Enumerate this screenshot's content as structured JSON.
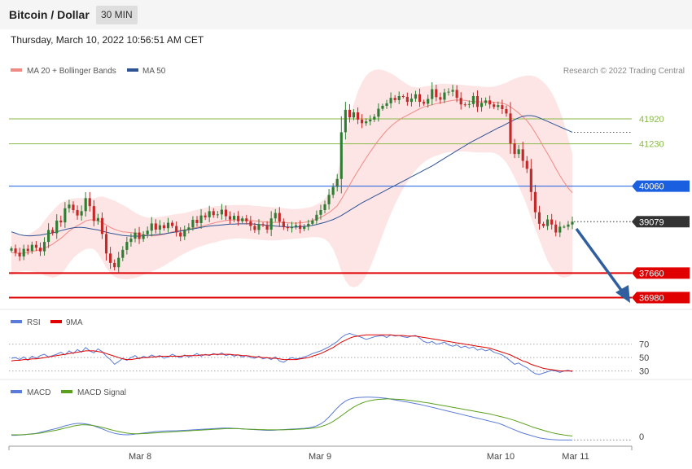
{
  "header": {
    "title": "Bitcoin / Dollar",
    "timeframe": "30 MIN",
    "timestamp": "Thursday, March 10, 2022 10:56:51 AM CET"
  },
  "colors": {
    "ma20": "#f08a84",
    "bb_fill": "#fde0e0",
    "ma50": "#2e5395",
    "up": "#2e7d32",
    "down": "#c62828",
    "support": "#e00000",
    "blue_level": "#1a5fe0",
    "green_level": "#8ab84a",
    "rsi": "#5a7bd8",
    "rsi_ma": "#e00000",
    "macd": "#5a7bd8",
    "macd_signal": "#5aa01e",
    "arrow": "#2f5f9e"
  },
  "chart_data": [
    {
      "type": "candlestick",
      "title": "",
      "legend": [
        {
          "name": "MA 20 + Bollinger Bands",
          "color": "#f08a84"
        },
        {
          "name": "MA 50",
          "color": "#2e5395"
        }
      ],
      "credit": "Research © 2022 Trading Central",
      "x_ticks": [
        "Mar 8",
        "Mar 9",
        "Mar 10",
        "Mar 11"
      ],
      "ylim": [
        36700,
        43000
      ],
      "levels": [
        {
          "value": 41920,
          "label": "41920",
          "style": "resistance"
        },
        {
          "value": 41230,
          "label": "41230",
          "style": "resistance"
        },
        {
          "value": 40060,
          "label": "40060",
          "style": "pivot"
        },
        {
          "value": 39079,
          "label": "39079",
          "style": "current"
        },
        {
          "value": 37660,
          "label": "37660",
          "style": "support"
        },
        {
          "value": 36980,
          "label": "36980",
          "style": "support"
        }
      ],
      "close": [
        38340,
        38220,
        38120,
        38330,
        38270,
        38440,
        38360,
        38260,
        38520,
        38850,
        38760,
        39110,
        39060,
        39450,
        39550,
        39400,
        39250,
        39370,
        39730,
        39510,
        39100,
        39180,
        38740,
        38200,
        37940,
        37820,
        38080,
        38300,
        38520,
        38610,
        38780,
        38600,
        38730,
        38830,
        39030,
        38860,
        38980,
        38900,
        39050,
        38960,
        38780,
        38670,
        38860,
        38920,
        39130,
        39040,
        39250,
        39200,
        39370,
        39260,
        39280,
        39410,
        39230,
        39140,
        39240,
        39090,
        39170,
        39090,
        38960,
        38850,
        39010,
        38980,
        38860,
        39170,
        39320,
        39080,
        38930,
        38900,
        38940,
        38980,
        38880,
        38940,
        39020,
        39110,
        39270,
        39400,
        39560,
        39820,
        40040,
        40260,
        41550,
        42170,
        41960,
        42100,
        41900,
        41800,
        41850,
        41900,
        41980,
        42200,
        42280,
        42350,
        42500,
        42440,
        42550,
        42530,
        42390,
        42480,
        42600,
        42390,
        42340,
        42470,
        42740,
        42520,
        42450,
        42650,
        42670,
        42720,
        42500,
        42320,
        42310,
        42330,
        42550,
        42250,
        42360,
        42430,
        42320,
        42250,
        42300,
        42190,
        42070,
        41240,
        40950,
        41080,
        40760,
        40540,
        39900,
        39340,
        39020,
        38960,
        39140,
        39000,
        38780,
        38940,
        38940,
        39000,
        39079
      ],
      "ma20": [
        38230,
        38210,
        38200,
        38210,
        38230,
        38260,
        38280,
        38300,
        38340,
        38400,
        38460,
        38540,
        38620,
        38720,
        38820,
        38900,
        38970,
        39030,
        39100,
        39130,
        39130,
        39100,
        39050,
        38990,
        38920,
        38870,
        38830,
        38800,
        38790,
        38780,
        38760,
        38740,
        38720,
        38700,
        38690,
        38690,
        38710,
        38730,
        38760,
        38800,
        38820,
        38830,
        38850,
        38870,
        38900,
        38920,
        38950,
        38980,
        39010,
        39040,
        39070,
        39090,
        39110,
        39120,
        39130,
        39130,
        39130,
        39120,
        39110,
        39100,
        39090,
        39080,
        39070,
        39060,
        39060,
        39060,
        39060,
        39050,
        39040,
        39040,
        39050,
        39060,
        39080,
        39110,
        39150,
        39200,
        39260,
        39330,
        39420,
        39520,
        39700,
        39900,
        40090,
        40290,
        40480,
        40660,
        40840,
        41010,
        41170,
        41330,
        41470,
        41600,
        41710,
        41810,
        41890,
        41960,
        42020,
        42080,
        42140,
        42200,
        42250,
        42280,
        42310,
        42340,
        42360,
        42390,
        42410,
        42430,
        42440,
        42440,
        42430,
        42410,
        42400,
        42390,
        42390,
        42390,
        42390,
        42380,
        42370,
        42350,
        42320,
        42250,
        42170,
        42080,
        41980,
        41870,
        41720,
        41540,
        41350,
        41150,
        40960,
        40760,
        40550,
        40350,
        40170,
        40010,
        39880
      ],
      "bb_upper": [
        38800,
        38740,
        38700,
        38700,
        38720,
        38780,
        38850,
        38950,
        39100,
        39250,
        39380,
        39500,
        39600,
        39660,
        39700,
        39720,
        39730,
        39730,
        39730,
        39720,
        39720,
        39760,
        39780,
        39740,
        39700,
        39660,
        39600,
        39540,
        39480,
        39400,
        39330,
        39270,
        39220,
        39190,
        39190,
        39200,
        39210,
        39230,
        39250,
        39270,
        39290,
        39300,
        39320,
        39350,
        39380,
        39410,
        39440,
        39460,
        39480,
        39500,
        39510,
        39520,
        39530,
        39530,
        39540,
        39540,
        39540,
        39540,
        39530,
        39520,
        39510,
        39500,
        39490,
        39480,
        39470,
        39460,
        39450,
        39440,
        39430,
        39430,
        39440,
        39450,
        39470,
        39500,
        39550,
        39620,
        39720,
        39860,
        40080,
        40370,
        40870,
        41420,
        41910,
        42330,
        42680,
        42930,
        43110,
        43220,
        43270,
        43290,
        43270,
        43230,
        43180,
        43110,
        43030,
        42950,
        42870,
        42810,
        42790,
        42790,
        42810,
        42830,
        42850,
        42870,
        42890,
        42890,
        42880,
        42880,
        42870,
        42860,
        42850,
        42840,
        42830,
        42820,
        42810,
        42800,
        42800,
        42810,
        42840,
        42880,
        42920,
        42980,
        43030,
        43070,
        43100,
        43120,
        43120,
        43090,
        43030,
        42940,
        42810,
        42640,
        42420,
        42140,
        41800,
        41400,
        40960
      ],
      "bb_lower": [
        37600,
        37650,
        37700,
        37720,
        37720,
        37700,
        37680,
        37650,
        37600,
        37560,
        37530,
        37560,
        37620,
        37760,
        37930,
        38070,
        38180,
        38260,
        38320,
        38340,
        38320,
        38200,
        38010,
        37800,
        37650,
        37560,
        37510,
        37490,
        37480,
        37500,
        37520,
        37560,
        37610,
        37650,
        37700,
        37750,
        37800,
        37860,
        37930,
        38000,
        38070,
        38140,
        38200,
        38260,
        38310,
        38360,
        38400,
        38440,
        38470,
        38500,
        38530,
        38560,
        38580,
        38600,
        38610,
        38620,
        38620,
        38610,
        38600,
        38590,
        38580,
        38570,
        38560,
        38560,
        38560,
        38570,
        38580,
        38590,
        38600,
        38610,
        38620,
        38630,
        38640,
        38650,
        38650,
        38640,
        38600,
        38500,
        38320,
        38050,
        37700,
        37450,
        37300,
        37270,
        37300,
        37410,
        37590,
        37820,
        38100,
        38410,
        38720,
        39020,
        39300,
        39560,
        39790,
        40000,
        40180,
        40350,
        40500,
        40620,
        40720,
        40800,
        40860,
        40900,
        40940,
        40980,
        41000,
        41010,
        41020,
        41020,
        41020,
        41010,
        41000,
        40990,
        40990,
        40990,
        40990,
        40980,
        40930,
        40840,
        40710,
        40520,
        40300,
        40060,
        39800,
        39520,
        39200,
        38880,
        38580,
        38280,
        38000,
        37800,
        37650,
        37560,
        37530,
        37560,
        37620
      ],
      "ma50": [
        38800,
        38760,
        38720,
        38700,
        38690,
        38690,
        38700,
        38710,
        38730,
        38750,
        38770,
        38800,
        38830,
        38860,
        38890,
        38910,
        38920,
        38920,
        38910,
        38890,
        38870,
        38850,
        38820,
        38790,
        38760,
        38740,
        38720,
        38700,
        38690,
        38680,
        38680,
        38680,
        38690,
        38700,
        38710,
        38720,
        38730,
        38740,
        38760,
        38780,
        38800,
        38820,
        38840,
        38860,
        38880,
        38900,
        38920,
        38940,
        38960,
        38970,
        38980,
        38990,
        39000,
        39010,
        39010,
        39020,
        39020,
        39020,
        39020,
        39010,
        39000,
        38990,
        38980,
        38970,
        38960,
        38950,
        38940,
        38930,
        38930,
        38930,
        38940,
        38950,
        38960,
        38980,
        39000,
        39030,
        39060,
        39100,
        39140,
        39190,
        39250,
        39320,
        39390,
        39460,
        39530,
        39600,
        39660,
        39720,
        39780,
        39840,
        39900,
        39960,
        40020,
        40080,
        40140,
        40200,
        40260,
        40320,
        40380,
        40440,
        40500,
        40560,
        40620,
        40690,
        40760,
        40830,
        40900,
        40970,
        41040,
        41110,
        41180,
        41250,
        41310,
        41370,
        41430,
        41490,
        41550,
        41610,
        41670,
        41720,
        41780,
        41840,
        41900,
        41950,
        41990,
        42010,
        42010,
        41990,
        41950,
        41900,
        41850,
        41800,
        41750,
        41700,
        41650,
        41600,
        41550
      ]
    },
    {
      "type": "line",
      "title": "",
      "legend": [
        {
          "name": "RSI",
          "color": "#5a7bd8"
        },
        {
          "name": "9MA",
          "color": "#e00000"
        }
      ],
      "ylim": [
        15,
        100
      ],
      "y_ticks": [
        "70",
        "50",
        "30"
      ],
      "levels": [
        70,
        50,
        30
      ],
      "rsi": [
        49,
        50,
        47,
        51,
        46,
        52,
        49,
        53,
        55,
        51,
        53,
        55,
        58,
        54,
        60,
        56,
        62,
        58,
        65,
        60,
        57,
        63,
        59,
        52,
        47,
        40,
        44,
        49,
        46,
        50,
        53,
        48,
        52,
        50,
        54,
        51,
        53,
        49,
        51,
        55,
        52,
        50,
        54,
        51,
        53,
        56,
        52,
        55,
        53,
        56,
        54,
        57,
        53,
        55,
        52,
        54,
        51,
        53,
        50,
        49,
        52,
        48,
        50,
        47,
        51,
        45,
        43,
        47,
        50,
        48,
        49,
        51,
        53,
        56,
        58,
        60,
        63,
        66,
        70,
        74,
        80,
        84,
        86,
        84,
        82,
        80,
        77,
        79,
        81,
        82,
        83,
        80,
        84,
        82,
        83,
        81,
        80,
        82,
        83,
        79,
        74,
        72,
        74,
        70,
        71,
        73,
        69,
        67,
        69,
        65,
        67,
        64,
        66,
        61,
        63,
        60,
        62,
        58,
        56,
        54,
        50,
        45,
        40,
        42,
        38,
        35,
        30,
        26,
        25,
        27,
        29,
        31,
        30,
        28,
        30,
        31,
        29
      ],
      "rsi_ma": [
        45,
        46,
        46,
        47,
        47,
        48,
        48,
        49,
        50,
        51,
        52,
        53,
        54,
        55,
        56,
        57,
        58,
        59,
        60,
        60,
        60,
        59,
        58,
        56,
        54,
        52,
        50,
        48,
        47,
        47,
        48,
        49,
        50,
        50,
        51,
        51,
        52,
        52,
        52,
        52,
        52,
        52,
        53,
        53,
        53,
        53,
        54,
        54,
        54,
        55,
        55,
        55,
        55,
        55,
        54,
        54,
        53,
        53,
        52,
        51,
        51,
        50,
        50,
        49,
        49,
        48,
        47,
        47,
        47,
        47,
        48,
        49,
        50,
        52,
        54,
        56,
        59,
        62,
        65,
        69,
        73,
        76,
        79,
        81,
        82,
        83,
        84,
        84,
        84,
        84,
        84,
        84,
        84,
        83,
        83,
        83,
        82,
        82,
        82,
        81,
        80,
        79,
        78,
        77,
        76,
        75,
        74,
        73,
        72,
        71,
        70,
        69,
        68,
        67,
        66,
        65,
        64,
        62,
        60,
        58,
        56,
        54,
        51,
        48,
        45,
        43,
        40,
        38,
        36,
        34,
        33,
        32,
        31,
        30,
        30,
        30,
        30
      ]
    },
    {
      "type": "line",
      "title": "",
      "legend": [
        {
          "name": "MACD",
          "color": "#5a7bd8"
        },
        {
          "name": "MACD Signal",
          "color": "#5aa01e"
        }
      ],
      "ylim": [
        -400,
        1900
      ],
      "y_ticks": [
        "0"
      ],
      "zero_line": true,
      "macd": [
        40,
        40,
        50,
        60,
        80,
        100,
        120,
        160,
        200,
        240,
        280,
        320,
        370,
        420,
        460,
        500,
        520,
        520,
        500,
        470,
        420,
        360,
        300,
        230,
        170,
        120,
        90,
        70,
        60,
        70,
        90,
        110,
        130,
        150,
        170,
        190,
        200,
        210,
        220,
        220,
        220,
        230,
        240,
        250,
        260,
        270,
        280,
        290,
        300,
        310,
        320,
        330,
        330,
        330,
        320,
        310,
        300,
        290,
        280,
        270,
        260,
        250,
        240,
        240,
        250,
        260,
        270,
        280,
        290,
        300,
        310,
        320,
        340,
        370,
        420,
        500,
        620,
        780,
        960,
        1140,
        1300,
        1420,
        1500,
        1540,
        1560,
        1570,
        1580,
        1580,
        1570,
        1560,
        1550,
        1530,
        1500,
        1470,
        1440,
        1410,
        1380,
        1350,
        1320,
        1290,
        1250,
        1210,
        1170,
        1130,
        1090,
        1050,
        1010,
        970,
        930,
        890,
        850,
        810,
        770,
        730,
        690,
        650,
        610,
        570,
        530,
        470,
        400,
        330,
        260,
        190,
        130,
        80,
        30,
        -20,
        -60,
        -90,
        -110,
        -130,
        -140,
        -150,
        -150,
        -150,
        -150
      ],
      "signal": [
        60,
        60,
        60,
        70,
        80,
        90,
        110,
        130,
        160,
        190,
        220,
        250,
        290,
        330,
        370,
        410,
        440,
        460,
        460,
        450,
        430,
        400,
        360,
        320,
        270,
        230,
        190,
        160,
        130,
        110,
        100,
        100,
        110,
        120,
        130,
        140,
        150,
        160,
        170,
        180,
        190,
        200,
        210,
        220,
        230,
        240,
        250,
        260,
        270,
        280,
        290,
        300,
        310,
        310,
        310,
        310,
        300,
        290,
        280,
        280,
        270,
        270,
        260,
        260,
        260,
        260,
        260,
        270,
        270,
        280,
        290,
        300,
        310,
        330,
        350,
        390,
        440,
        510,
        600,
        710,
        830,
        950,
        1070,
        1180,
        1270,
        1340,
        1400,
        1440,
        1470,
        1490,
        1500,
        1510,
        1510,
        1500,
        1490,
        1480,
        1460,
        1440,
        1420,
        1400,
        1370,
        1350,
        1320,
        1290,
        1260,
        1230,
        1200,
        1170,
        1140,
        1110,
        1080,
        1050,
        1020,
        990,
        960,
        930,
        900,
        860,
        820,
        780,
        740,
        690,
        640,
        580,
        520,
        460,
        400,
        340,
        290,
        240,
        190,
        150,
        110,
        80,
        50,
        30,
        10
      ]
    }
  ]
}
